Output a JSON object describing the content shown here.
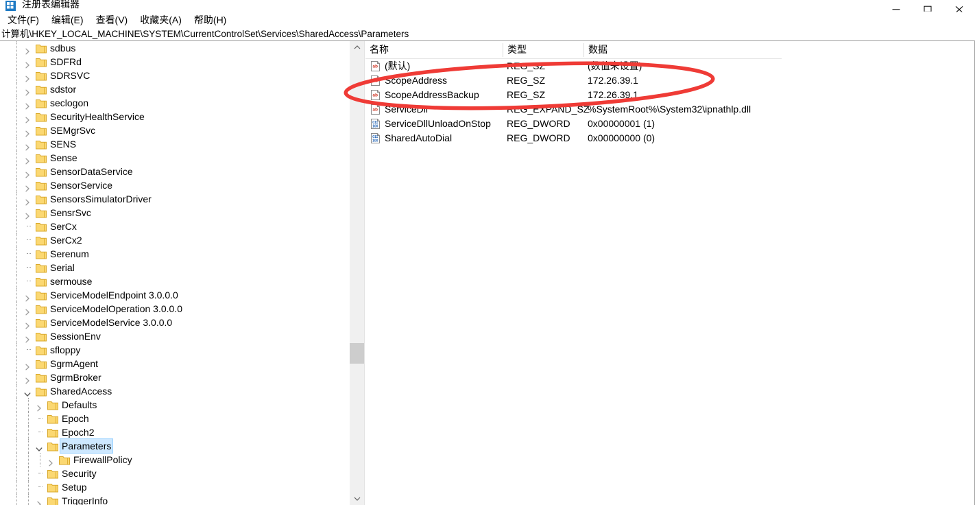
{
  "window": {
    "title": "注册表编辑器",
    "icon": "registry-editor-icon",
    "controls": {
      "minimize": "minimize-icon",
      "maximize": "maximize-icon",
      "close": "close-icon"
    }
  },
  "menu": {
    "items": [
      {
        "label": "文件(F)"
      },
      {
        "label": "编辑(E)"
      },
      {
        "label": "查看(V)"
      },
      {
        "label": "收藏夹(A)"
      },
      {
        "label": "帮助(H)"
      }
    ]
  },
  "address": {
    "path": "计算机\\HKEY_LOCAL_MACHINE\\SYSTEM\\CurrentControlSet\\Services\\SharedAccess\\Parameters"
  },
  "tree": {
    "items": [
      {
        "label": "sdbus",
        "depth": 2,
        "expander": "collapsed"
      },
      {
        "label": "SDFRd",
        "depth": 2,
        "expander": "collapsed"
      },
      {
        "label": "SDRSVC",
        "depth": 2,
        "expander": "collapsed"
      },
      {
        "label": "sdstor",
        "depth": 2,
        "expander": "collapsed"
      },
      {
        "label": "seclogon",
        "depth": 2,
        "expander": "collapsed"
      },
      {
        "label": "SecurityHealthService",
        "depth": 2,
        "expander": "collapsed"
      },
      {
        "label": "SEMgrSvc",
        "depth": 2,
        "expander": "collapsed"
      },
      {
        "label": "SENS",
        "depth": 2,
        "expander": "collapsed"
      },
      {
        "label": "Sense",
        "depth": 2,
        "expander": "collapsed"
      },
      {
        "label": "SensorDataService",
        "depth": 2,
        "expander": "collapsed"
      },
      {
        "label": "SensorService",
        "depth": 2,
        "expander": "collapsed"
      },
      {
        "label": "SensorsSimulatorDriver",
        "depth": 2,
        "expander": "collapsed"
      },
      {
        "label": "SensrSvc",
        "depth": 2,
        "expander": "collapsed"
      },
      {
        "label": "SerCx",
        "depth": 2,
        "expander": "none"
      },
      {
        "label": "SerCx2",
        "depth": 2,
        "expander": "none"
      },
      {
        "label": "Serenum",
        "depth": 2,
        "expander": "none"
      },
      {
        "label": "Serial",
        "depth": 2,
        "expander": "none"
      },
      {
        "label": "sermouse",
        "depth": 2,
        "expander": "none"
      },
      {
        "label": "ServiceModelEndpoint 3.0.0.0",
        "depth": 2,
        "expander": "collapsed"
      },
      {
        "label": "ServiceModelOperation 3.0.0.0",
        "depth": 2,
        "expander": "collapsed"
      },
      {
        "label": "ServiceModelService 3.0.0.0",
        "depth": 2,
        "expander": "collapsed"
      },
      {
        "label": "SessionEnv",
        "depth": 2,
        "expander": "collapsed"
      },
      {
        "label": "sfloppy",
        "depth": 2,
        "expander": "none"
      },
      {
        "label": "SgrmAgent",
        "depth": 2,
        "expander": "collapsed"
      },
      {
        "label": "SgrmBroker",
        "depth": 2,
        "expander": "collapsed"
      },
      {
        "label": "SharedAccess",
        "depth": 2,
        "expander": "expanded"
      },
      {
        "label": "Defaults",
        "depth": 3,
        "expander": "collapsed"
      },
      {
        "label": "Epoch",
        "depth": 3,
        "expander": "none"
      },
      {
        "label": "Epoch2",
        "depth": 3,
        "expander": "none"
      },
      {
        "label": "Parameters",
        "depth": 3,
        "expander": "expanded",
        "selected": true
      },
      {
        "label": "FirewallPolicy",
        "depth": 4,
        "expander": "collapsed"
      },
      {
        "label": "Security",
        "depth": 3,
        "expander": "none"
      },
      {
        "label": "Setup",
        "depth": 3,
        "expander": "none"
      },
      {
        "label": "TriggerInfo",
        "depth": 3,
        "expander": "collapsed"
      }
    ]
  },
  "values": {
    "columns": [
      {
        "label": "名称"
      },
      {
        "label": "类型"
      },
      {
        "label": "数据"
      }
    ],
    "rows": [
      {
        "name": "(默认)",
        "type": "REG_SZ",
        "data": "(数值未设置)",
        "icon": "string-value-icon"
      },
      {
        "name": "ScopeAddress",
        "type": "REG_SZ",
        "data": "172.26.39.1",
        "icon": "string-value-icon"
      },
      {
        "name": "ScopeAddressBackup",
        "type": "REG_SZ",
        "data": "172.26.39.1",
        "icon": "string-value-icon"
      },
      {
        "name": "ServiceDll",
        "type": "REG_EXPAND_SZ",
        "data": "%SystemRoot%\\System32\\ipnathlp.dll",
        "icon": "string-value-icon"
      },
      {
        "name": "ServiceDllUnloadOnStop",
        "type": "REG_DWORD",
        "data": "0x00000001 (1)",
        "icon": "dword-value-icon"
      },
      {
        "name": "SharedAutoDial",
        "type": "REG_DWORD",
        "data": "0x00000000 (0)",
        "icon": "dword-value-icon"
      }
    ]
  },
  "annotation": {
    "shape": "red-ellipse-highlight",
    "color": "#ef3b36"
  }
}
